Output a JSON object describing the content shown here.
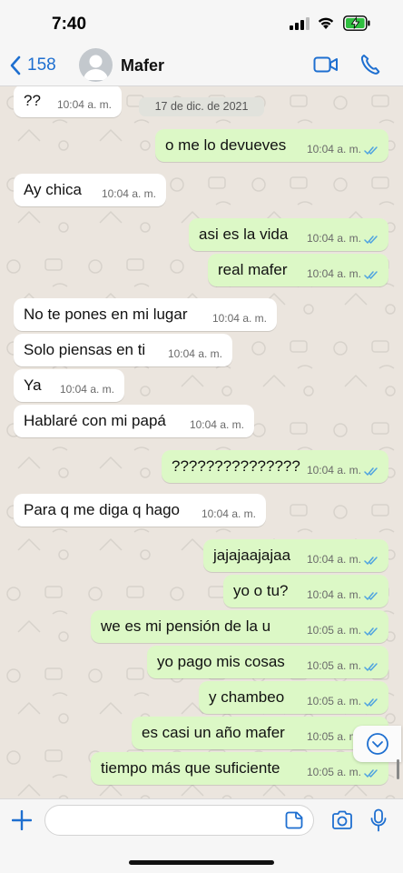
{
  "status_bar": {
    "time": "7:40"
  },
  "header": {
    "back_count": "158",
    "contact_name": "Mafer"
  },
  "chat": {
    "date_chip": "17 de dic. de 2021",
    "messages": [
      {
        "dir": "in",
        "text": "??",
        "time": "10:04 a. m."
      },
      {
        "dir": "out",
        "text": "o me lo devueves",
        "time": "10:04 a. m.",
        "read": true
      },
      {
        "dir": "in",
        "text": "Ay chica",
        "time": "10:04 a. m."
      },
      {
        "dir": "out",
        "text": "asi es la vida",
        "time": "10:04 a. m.",
        "read": true
      },
      {
        "dir": "out",
        "text": "real mafer",
        "time": "10:04 a. m.",
        "read": true
      },
      {
        "dir": "in",
        "text": "No te pones en mi lugar",
        "time": "10:04 a. m."
      },
      {
        "dir": "in",
        "text": "Solo piensas en ti",
        "time": "10:04 a. m."
      },
      {
        "dir": "in",
        "text": "Ya",
        "time": "10:04 a. m."
      },
      {
        "dir": "in",
        "text": "Hablaré con mi papá",
        "time": "10:04 a. m."
      },
      {
        "dir": "out",
        "text": "???????????????",
        "time": "10:04 a. m.",
        "read": true
      },
      {
        "dir": "in",
        "text": "Para q me diga q hago",
        "time": "10:04 a. m."
      },
      {
        "dir": "out",
        "text": "jajajaajajaa",
        "time": "10:04 a. m.",
        "read": true
      },
      {
        "dir": "out",
        "text": "yo o tu?",
        "time": "10:04 a. m.",
        "read": true
      },
      {
        "dir": "out",
        "text": "we es mi pensión de la u",
        "time": "10:05 a. m.",
        "read": true
      },
      {
        "dir": "out",
        "text": "yo pago mis cosas",
        "time": "10:05 a. m.",
        "read": true
      },
      {
        "dir": "out",
        "text": "y chambeo",
        "time": "10:05 a. m.",
        "read": true
      },
      {
        "dir": "out",
        "text": "es casi un año mafer",
        "time": "10:05 a. m.",
        "read": true
      },
      {
        "dir": "out",
        "text": "tiempo más que suficiente",
        "time": "10:05 a. m.",
        "read": true
      }
    ]
  },
  "composer": {
    "input_value": "",
    "input_placeholder": ""
  },
  "colors": {
    "accent": "#1e6fd0",
    "outgoing_bubble": "#dcf8c6",
    "incoming_bubble": "#ffffff",
    "chat_background": "#ebe5de",
    "read_ticks": "#4fa3e0"
  },
  "icons": {
    "back": "chevron-left-icon",
    "video_call": "video-camera-icon",
    "phone": "phone-icon",
    "plus": "plus-icon",
    "sticker": "sticker-icon",
    "camera": "camera-icon",
    "mic": "microphone-icon",
    "scroll_down": "chevron-down-circle-icon",
    "read_receipt": "double-check-icon"
  }
}
